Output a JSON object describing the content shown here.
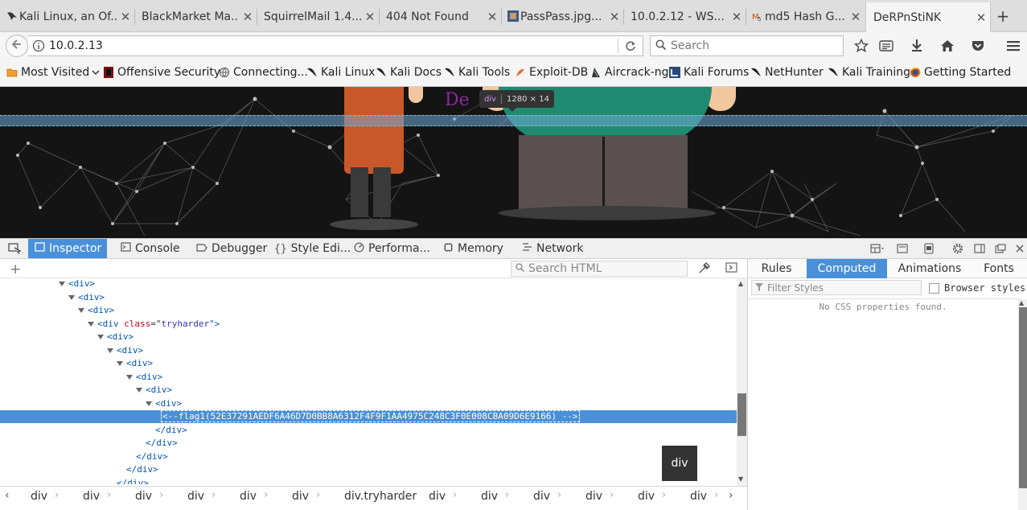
{
  "browser": {
    "tabs": [
      {
        "title": "Kali Linux, an Of...",
        "favicon": "kali-dragon-icon"
      },
      {
        "title": "BlackMarket Ma...",
        "favicon": "none"
      },
      {
        "title": "SquirrelMail 1.4....",
        "favicon": "none"
      },
      {
        "title": "404 Not Found",
        "favicon": "none"
      },
      {
        "title": "PassPass.jpg...",
        "favicon": "image-icon"
      },
      {
        "title": "10.0.2.12 - WS...",
        "favicon": "none"
      },
      {
        "title": "md5 Hash G...",
        "favicon": "md5-icon"
      },
      {
        "title": "DeRPnStiNK",
        "favicon": "none",
        "selected": true
      }
    ],
    "close_glyph": "✕",
    "new_tab_glyph": "+",
    "url": "10.0.2.13",
    "search_placeholder": "Search",
    "bookmarks": [
      {
        "label": "Most Visited",
        "icon": "folder-icon",
        "dropdown": true
      },
      {
        "label": "Offensive Security",
        "icon": "offsec-icon"
      },
      {
        "label": "Connecting...",
        "icon": "globe-icon"
      },
      {
        "label": "Kali Linux",
        "icon": "kali-dragon-icon"
      },
      {
        "label": "Kali Docs",
        "icon": "kali-dragon-icon"
      },
      {
        "label": "Kali Tools",
        "icon": "kali-dragon-icon"
      },
      {
        "label": "Exploit-DB",
        "icon": "exploitdb-icon"
      },
      {
        "label": "Aircrack-ng",
        "icon": "aircrack-icon"
      },
      {
        "label": "Kali Forums",
        "icon": "kali-forums-icon"
      },
      {
        "label": "NetHunter",
        "icon": "kali-dragon-icon"
      },
      {
        "label": "Kali Training",
        "icon": "kali-dragon-icon"
      },
      {
        "label": "Getting Started",
        "icon": "firefox-icon"
      }
    ]
  },
  "page": {
    "highlight_tooltip": {
      "tag": "div",
      "size": "1280 × 14"
    },
    "partial_text": "De"
  },
  "devtools": {
    "tabs": [
      {
        "label": "Inspector",
        "icon": "inspector-icon",
        "selected": true
      },
      {
        "label": "Console",
        "icon": "console-icon"
      },
      {
        "label": "Debugger",
        "icon": "debugger-icon"
      },
      {
        "label": "Style Edi...",
        "icon": "style-editor-icon"
      },
      {
        "label": "Performa...",
        "icon": "performance-icon"
      },
      {
        "label": "Memory",
        "icon": "memory-icon"
      },
      {
        "label": "Network",
        "icon": "network-icon"
      }
    ],
    "search_html_placeholder": "Search HTML",
    "tree": [
      {
        "indent": 0,
        "open": true,
        "text": "<div>"
      },
      {
        "indent": 1,
        "open": true,
        "text": "<div>"
      },
      {
        "indent": 2,
        "open": true,
        "text": "<div>"
      },
      {
        "indent": 3,
        "open": true,
        "tag": "div",
        "attr": "class",
        "val": "tryharder"
      },
      {
        "indent": 4,
        "open": true,
        "text": "<div>"
      },
      {
        "indent": 5,
        "open": true,
        "text": "<div>"
      },
      {
        "indent": 6,
        "open": true,
        "text": "<div>"
      },
      {
        "indent": 7,
        "open": true,
        "text": "<div>"
      },
      {
        "indent": 8,
        "open": true,
        "text": "<div>"
      },
      {
        "indent": 9,
        "open": true,
        "text": "<div>"
      },
      {
        "indent": 10,
        "selected": true,
        "text": "<--flag1(52E37291AEDF6A46D7D0BB8A6312F4F9F1AA4975C248C3F0E008CBA09D6E9166) -->"
      },
      {
        "indent": 9,
        "close": true,
        "text": "</div>"
      },
      {
        "indent": 8,
        "close": true,
        "text": "</div>"
      },
      {
        "indent": 7,
        "close": true,
        "text": "</div>"
      },
      {
        "indent": 6,
        "close": true,
        "text": "</div>"
      },
      {
        "indent": 5,
        "close": true,
        "text": "</div>"
      }
    ],
    "tooltip": "div",
    "breadcrumbs": [
      "div",
      "div",
      "div",
      "div",
      "div",
      "div",
      "div.tryharder",
      "div",
      "div",
      "div",
      "div",
      "div",
      "div"
    ],
    "side_tabs": [
      "Rules",
      "Computed",
      "Animations",
      "Fonts"
    ],
    "side_selected": "Computed",
    "filter_placeholder": "Filter Styles",
    "browser_styles_label": "Browser styles",
    "empty_message": "No CSS properties found."
  }
}
